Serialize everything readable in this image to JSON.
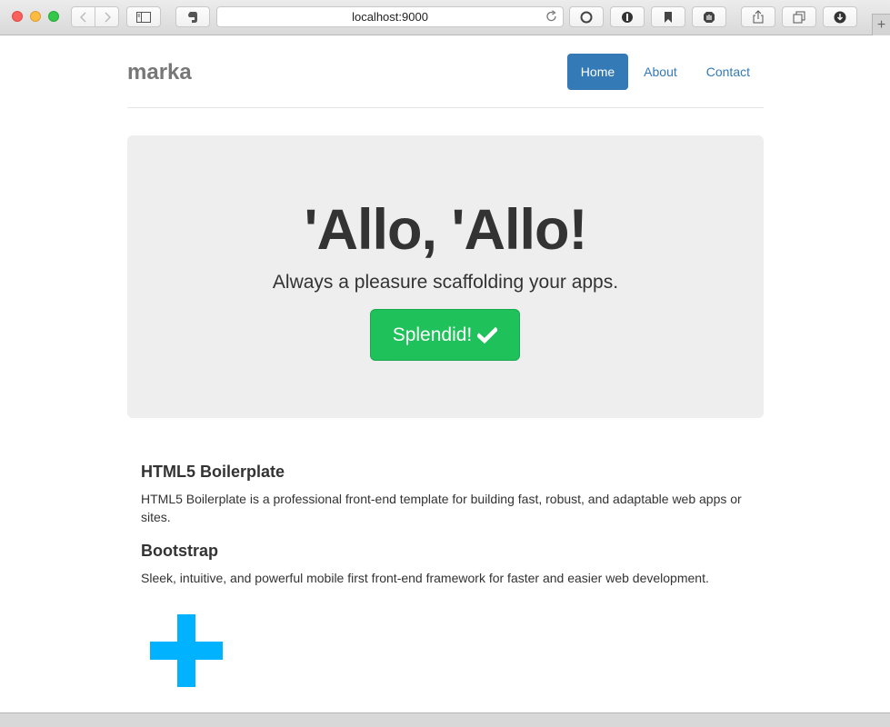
{
  "browser": {
    "url": "localhost:9000",
    "icons": {
      "back": "chevron-left-icon",
      "forward": "chevron-right-icon",
      "sidebar": "sidebar-icon",
      "evernote": "evernote-icon",
      "reload": "reload-icon",
      "share": "share-icon",
      "tabs": "tabs-icon",
      "download": "download-icon",
      "new_tab": "+"
    }
  },
  "site": {
    "brand": "marka",
    "nav": [
      {
        "label": "Home",
        "active": true
      },
      {
        "label": "About",
        "active": false
      },
      {
        "label": "Contact",
        "active": false
      }
    ]
  },
  "jumbotron": {
    "title": "'Allo, 'Allo!",
    "lead": "Always a pleasure scaffolding your apps.",
    "button_label": "Splendid!",
    "button_color": "#1ec15a"
  },
  "marketing": [
    {
      "heading": "HTML5 Boilerplate",
      "text": "HTML5 Boilerplate is a professional front-end template for building fast, robust, and adaptable web apps or sites."
    },
    {
      "heading": "Bootstrap",
      "text": "Sleek, intuitive, and powerful mobile first front-end framework for faster and easier web development."
    }
  ],
  "colors": {
    "plus": "#00b2ff",
    "link": "#337ab7"
  }
}
